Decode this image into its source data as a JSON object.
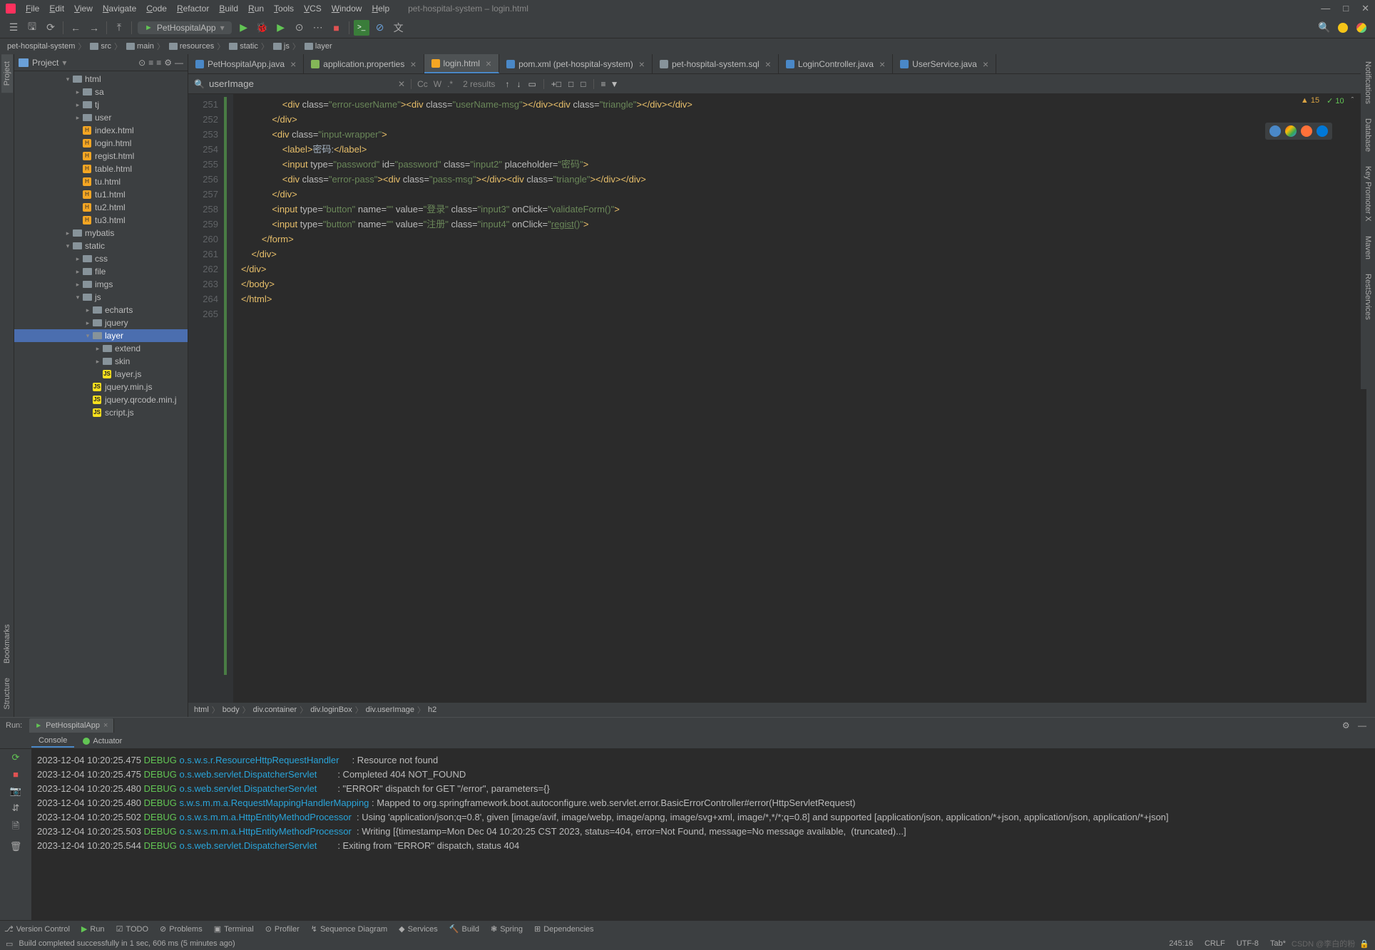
{
  "window": {
    "title": "pet-hospital-system – login.html",
    "menus": [
      "File",
      "Edit",
      "View",
      "Navigate",
      "Code",
      "Refactor",
      "Build",
      "Run",
      "Tools",
      "VCS",
      "Window",
      "Help"
    ]
  },
  "toolbar": {
    "run_config": "PetHospitalApp"
  },
  "breadcrumb": [
    "pet-hospital-system",
    "src",
    "main",
    "resources",
    "static",
    "js",
    "layer"
  ],
  "project": {
    "title": "Project",
    "tree": [
      {
        "depth": 5,
        "type": "folder",
        "arrow": "▾",
        "label": "html"
      },
      {
        "depth": 6,
        "type": "folder",
        "arrow": "▸",
        "label": "sa"
      },
      {
        "depth": 6,
        "type": "folder",
        "arrow": "▸",
        "label": "tj"
      },
      {
        "depth": 6,
        "type": "folder",
        "arrow": "▸",
        "label": "user"
      },
      {
        "depth": 6,
        "type": "html",
        "label": "index.html"
      },
      {
        "depth": 6,
        "type": "html",
        "label": "login.html"
      },
      {
        "depth": 6,
        "type": "html",
        "label": "regist.html"
      },
      {
        "depth": 6,
        "type": "html",
        "label": "table.html"
      },
      {
        "depth": 6,
        "type": "html",
        "label": "tu.html"
      },
      {
        "depth": 6,
        "type": "html",
        "label": "tu1.html"
      },
      {
        "depth": 6,
        "type": "html",
        "label": "tu2.html"
      },
      {
        "depth": 6,
        "type": "html",
        "label": "tu3.html"
      },
      {
        "depth": 5,
        "type": "folder",
        "arrow": "▸",
        "label": "mybatis"
      },
      {
        "depth": 5,
        "type": "folder",
        "arrow": "▾",
        "label": "static"
      },
      {
        "depth": 6,
        "type": "folder",
        "arrow": "▸",
        "label": "css"
      },
      {
        "depth": 6,
        "type": "folder",
        "arrow": "▸",
        "label": "file"
      },
      {
        "depth": 6,
        "type": "folder",
        "arrow": "▸",
        "label": "imgs"
      },
      {
        "depth": 6,
        "type": "folder",
        "arrow": "▾",
        "label": "js"
      },
      {
        "depth": 7,
        "type": "folder",
        "arrow": "▸",
        "label": "echarts"
      },
      {
        "depth": 7,
        "type": "folder",
        "arrow": "▸",
        "label": "jquery"
      },
      {
        "depth": 7,
        "type": "folder",
        "arrow": "▾",
        "label": "layer",
        "selected": true
      },
      {
        "depth": 8,
        "type": "folder",
        "arrow": "▸",
        "label": "extend"
      },
      {
        "depth": 8,
        "type": "folder",
        "arrow": "▸",
        "label": "skin"
      },
      {
        "depth": 8,
        "type": "js",
        "label": "layer.js"
      },
      {
        "depth": 7,
        "type": "js",
        "label": "jquery.min.js"
      },
      {
        "depth": 7,
        "type": "js",
        "label": "jquery.qrcode.min.j"
      },
      {
        "depth": 7,
        "type": "js",
        "label": "script.js"
      }
    ]
  },
  "editor": {
    "tabs": [
      {
        "label": "PetHospitalApp.java",
        "color": "#4a88c7"
      },
      {
        "label": "application.properties",
        "color": "#84b658"
      },
      {
        "label": "login.html",
        "color": "#f5a623",
        "active": true
      },
      {
        "label": "pom.xml (pet-hospital-system)",
        "color": "#4a88c7"
      },
      {
        "label": "pet-hospital-system.sql",
        "color": "#87939a"
      },
      {
        "label": "LoginController.java",
        "color": "#4a88c7"
      },
      {
        "label": "UserService.java",
        "color": "#4a88c7"
      }
    ],
    "find": {
      "query": "userImage",
      "results": "2 results"
    },
    "inspection": {
      "warn": "15",
      "weak": "10"
    },
    "lines_start": 251,
    "lines": 15,
    "code_html": [
      "                <span class='tag'>&lt;div </span><span class='attr'>class=</span><span class='str'>\"error-userName\"</span><span class='tag'>&gt;&lt;div </span><span class='attr'>class=</span><span class='str'>\"userName-msg\"</span><span class='tag'>&gt;&lt;/div&gt;&lt;div </span><span class='attr'>class=</span><span class='str'>\"triangle\"</span><span class='tag'>&gt;&lt;/div&gt;&lt;/div&gt;</span>",
      "            <span class='tag'>&lt;/div&gt;</span>",
      "            <span class='tag'>&lt;div </span><span class='attr'>class=</span><span class='str'>\"input-wrapper\"</span><span class='tag'>&gt;</span>",
      "                <span class='tag'>&lt;label&gt;</span><span class='text'>密码:</span><span class='tag'>&lt;/label&gt;</span>",
      "                <span class='tag'>&lt;input </span><span class='attr'>type=</span><span class='str'>\"password\"</span> <span class='attr'>id=</span><span class='str'>\"password\"</span> <span class='attr'>class=</span><span class='str'>\"input2\"</span> <span class='attr'>placeholder=</span><span class='str'>\"密码\"</span><span class='tag'>&gt;</span>",
      "                <span class='tag'>&lt;div </span><span class='attr'>class=</span><span class='str'>\"error-pass\"</span><span class='tag'>&gt;&lt;div </span><span class='attr'>class=</span><span class='str'>\"pass-msg\"</span><span class='tag'>&gt;&lt;/div&gt;&lt;div </span><span class='attr'>class=</span><span class='str'>\"triangle\"</span><span class='tag'>&gt;&lt;/div&gt;&lt;/div&gt;</span>",
      "            <span class='tag'>&lt;/div&gt;</span>",
      "            <span class='tag'>&lt;input </span><span class='attr'>type=</span><span class='str'>\"button\"</span> <span class='attr'>name=</span><span class='str'>\"\"</span> <span class='attr'>value=</span><span class='str'>\"登录\"</span> <span class='attr'>class=</span><span class='str'>\"input3\"</span> <span class='attr'>onClick=</span><span class='str'>\"validateForm()\"</span><span class='tag'>&gt;</span>",
      "            <span class='tag'>&lt;input </span><span class='attr'>type=</span><span class='str'>\"button\"</span> <span class='attr'>name=</span><span class='str'>\"\"</span> <span class='attr'>value=</span><span class='str'>\"注册\"</span> <span class='attr'>class=</span><span class='str'>\"input4\"</span> <span class='attr'>onClick=</span><span class='str'>\"<u>regist</u>()\"</span><span class='tag'>&gt;</span>",
      "        <span class='tag'>&lt;/form&gt;</span>",
      "    <span class='tag'>&lt;/div&gt;</span>",
      "<span class='tag'>&lt;/div&gt;</span>",
      "<span class='tag'>&lt;/body&gt;</span>",
      "<span class='tag'>&lt;/html&gt;</span>",
      ""
    ],
    "path": [
      "html",
      "body",
      "div.container",
      "div.loginBox",
      "div.userImage",
      "h2"
    ]
  },
  "left_rails": [
    "Project",
    "Bookmarks",
    "Structure"
  ],
  "right_rails": [
    "Notifications",
    "Database",
    "Key Promoter X",
    "Maven",
    "RestServices"
  ],
  "run": {
    "label": "Run:",
    "tab": "PetHospitalApp",
    "subtabs": [
      "Console",
      "Actuator"
    ],
    "logs": [
      {
        "ts": "2023-12-04 10:20:25.475",
        "lvl": "DEBUG",
        "log": "o.s.w.s.r.ResourceHttpRequestHandler",
        "msg": ": Resource not found"
      },
      {
        "ts": "2023-12-04 10:20:25.475",
        "lvl": "DEBUG",
        "log": "o.s.web.servlet.DispatcherServlet",
        "msg": ": Completed 404 NOT_FOUND"
      },
      {
        "ts": "2023-12-04 10:20:25.480",
        "lvl": "DEBUG",
        "log": "o.s.web.servlet.DispatcherServlet",
        "msg": ": \"ERROR\" dispatch for GET \"/error\", parameters={}"
      },
      {
        "ts": "2023-12-04 10:20:25.480",
        "lvl": "DEBUG",
        "log": "s.w.s.m.m.a.RequestMappingHandlerMapping",
        "msg": ": Mapped to org.springframework.boot.autoconfigure.web.servlet.error.BasicErrorController#error(HttpServletRequest)"
      },
      {
        "ts": "2023-12-04 10:20:25.502",
        "lvl": "DEBUG",
        "log": "o.s.w.s.m.m.a.HttpEntityMethodProcessor",
        "msg": ": Using 'application/json;q=0.8', given [image/avif, image/webp, image/apng, image/svg+xml, image/*,*/*;q=0.8] and supported [application/json, application/*+json, application/json, application/*+json]"
      },
      {
        "ts": "2023-12-04 10:20:25.503",
        "lvl": "DEBUG",
        "log": "o.s.w.s.m.m.a.HttpEntityMethodProcessor",
        "msg": ": Writing [{timestamp=Mon Dec 04 10:20:25 CST 2023, status=404, error=Not Found, message=No message available,  (truncated)...]"
      },
      {
        "ts": "2023-12-04 10:20:25.544",
        "lvl": "DEBUG",
        "log": "o.s.web.servlet.DispatcherServlet",
        "msg": ": Exiting from \"ERROR\" dispatch, status 404"
      }
    ]
  },
  "bottom": {
    "items": [
      "Version Control",
      "Run",
      "TODO",
      "Problems",
      "Terminal",
      "Profiler",
      "Sequence Diagram",
      "Services",
      "Build",
      "Spring",
      "Dependencies"
    ]
  },
  "status": {
    "msg": "Build completed successfully in 1 sec, 606 ms (5 minutes ago)",
    "pos": "245:16",
    "sep": "CRLF",
    "enc": "UTF-8",
    "indent": "Tab*",
    "watermark": "CSDN @李白的粉"
  }
}
